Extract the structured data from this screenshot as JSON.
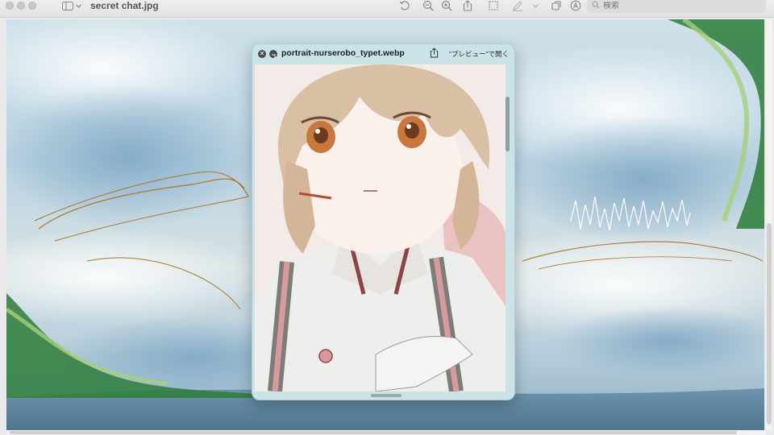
{
  "window": {
    "title": "secret chat.jpg",
    "search_placeholder": "検索"
  },
  "toolbar": {
    "icons": [
      "sidebar-icon",
      "chevron-down-icon",
      "rotate-icon",
      "zoom-out-icon",
      "zoom-in-icon",
      "share-icon",
      "crop-icon",
      "markup-pen-icon",
      "chevron-down-icon",
      "window-icon",
      "annotate-icon",
      "search-icon"
    ]
  },
  "quicklook": {
    "filename": "portrait-nurserobo_typet.webp",
    "open_label": "\"プレビュー\"で開く",
    "background_color": "#c9e3e7"
  },
  "colors": {
    "toolbar_bg": "#e6e6e6",
    "sky": "#b9d3e2",
    "green_swirl": "#2e7d3a"
  }
}
